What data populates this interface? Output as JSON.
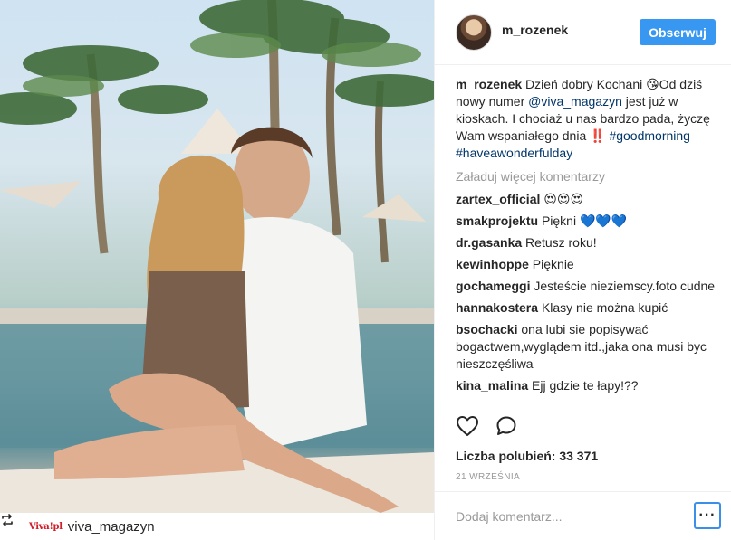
{
  "post": {
    "username": "m_rozenek",
    "follow_label": "Obserwuj",
    "repost_name": "viva_magazyn",
    "repost_logo_text": "Viva!pl"
  },
  "caption": {
    "username": "m_rozenek",
    "text_1": " Dzień dobry Kochani 😘Od dziś nowy numer ",
    "mention": "@viva_magazyn",
    "text_2": " jest już w kioskach. I chociaż u nas bardzo pada, życzę Wam wspaniałego dnia ‼️ ",
    "hashtag_1": "#goodmorning",
    "hashtag_2": "#haveawonderfulday"
  },
  "load_more": "Załaduj więcej komentarzy",
  "comments": [
    {
      "user": "zartex_official",
      "text": "😍😍😍"
    },
    {
      "user": "smakprojektu",
      "text": "Piękni 💙💙💙"
    },
    {
      "user": "dr.gasanka",
      "text": "Retusz roku!"
    },
    {
      "user": "kewinhoppe",
      "text": "Pięknie"
    },
    {
      "user": "gochameggi",
      "text": "Jesteście nieziemscy.foto cudne"
    },
    {
      "user": "hannakostera",
      "text": "Klasy nie można kupić"
    },
    {
      "user": "bsochacki",
      "text": "ona lubi sie popisywać bogactwem,wyglądem itd.,jaka ona musi byc nieszczęśliwa"
    },
    {
      "user": "kina_malina",
      "text": "Ejj gdzie te łapy!??"
    }
  ],
  "likes": "Liczba polubień: 33 371",
  "date": "21 WRZEŚNIA",
  "comment_placeholder": "Dodaj komentarz...",
  "more_label": "···",
  "icons": {
    "like": "heart-icon",
    "comment": "comment-icon",
    "repost": "repost-icon"
  },
  "colors": {
    "follow_button": "#3897f0",
    "link": "#003569",
    "muted": "#999999"
  }
}
